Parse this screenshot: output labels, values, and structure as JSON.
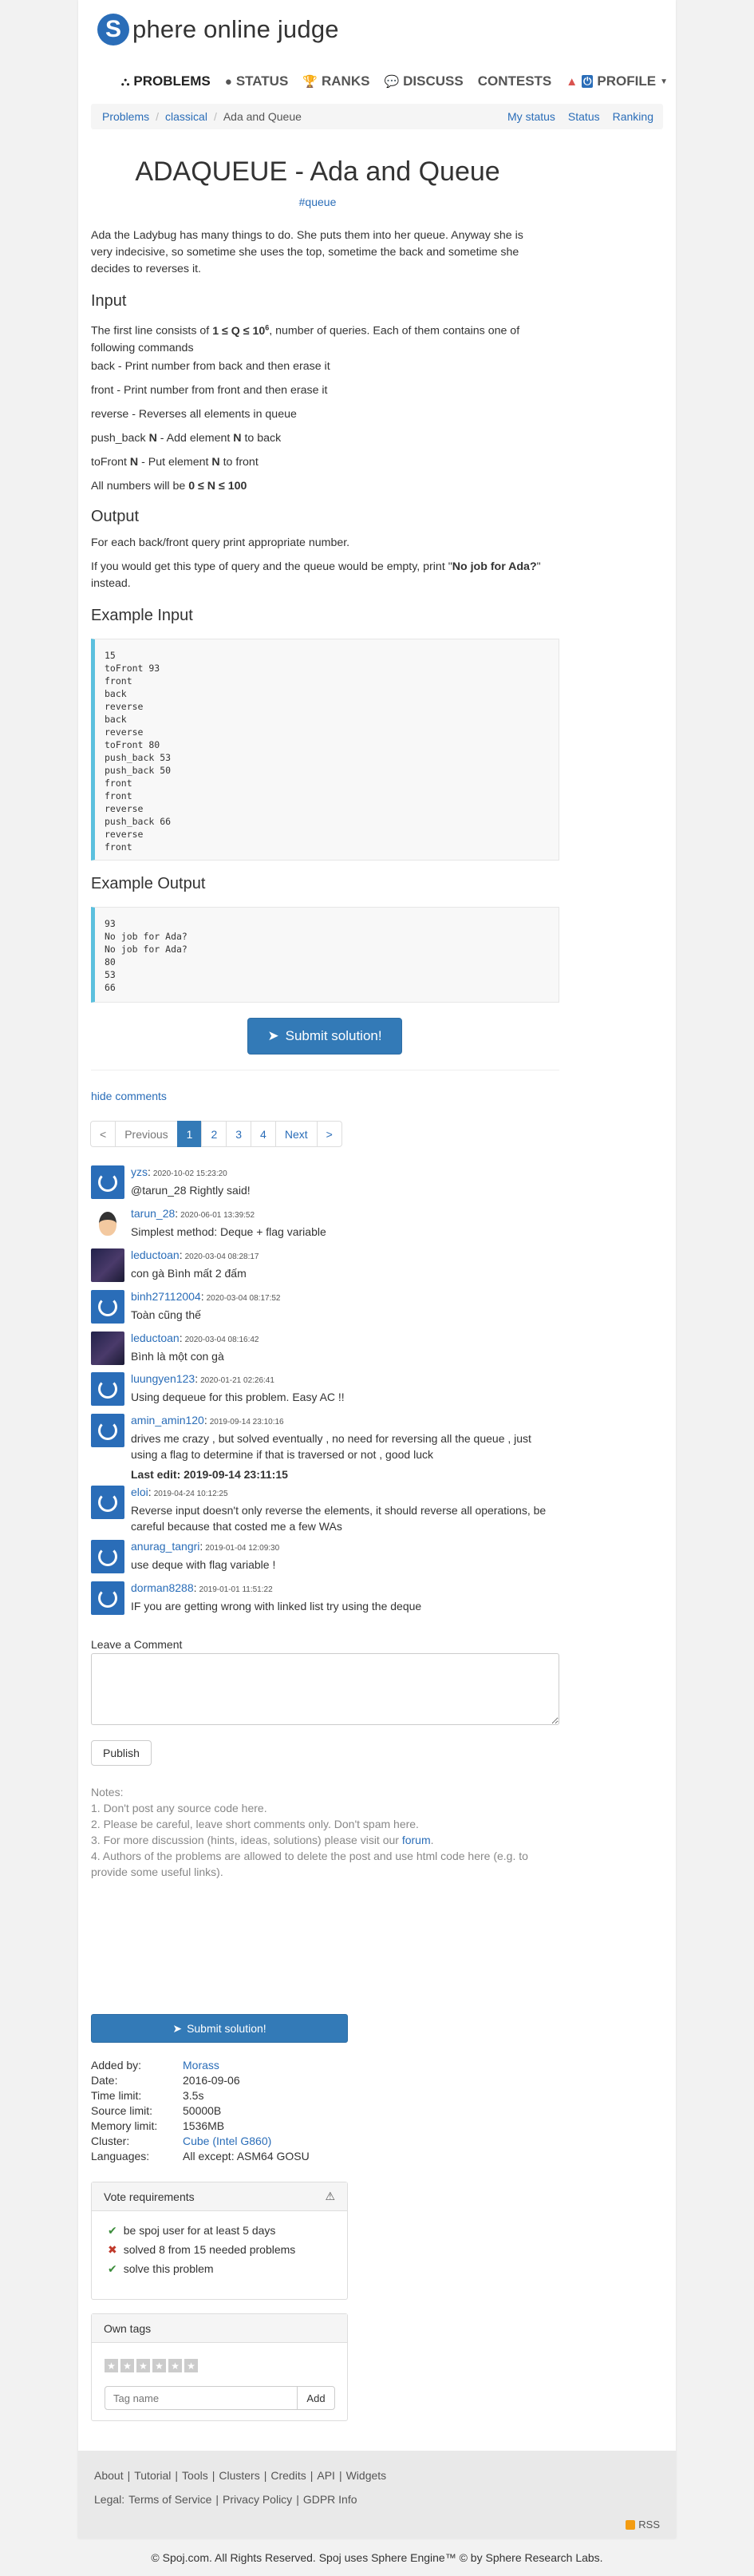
{
  "brand": {
    "initial": "S",
    "rest": "phere online judge"
  },
  "nav": [
    {
      "label": "Problems",
      "icon": "⛬"
    },
    {
      "label": "Status",
      "icon": "●"
    },
    {
      "label": "Ranks",
      "icon": "🏆"
    },
    {
      "label": "Discuss",
      "icon": "💬"
    },
    {
      "label": "Contests",
      "icon": ""
    },
    {
      "label": "Profile",
      "icon": "⏻"
    }
  ],
  "breadcrumb": {
    "items": [
      "Problems",
      "classical",
      "Ada and Queue"
    ],
    "right": [
      "My status",
      "Status",
      "Ranking"
    ]
  },
  "problem": {
    "title": "ADAQUEUE - Ada and Queue",
    "tag": "#queue",
    "intro": "Ada the Ladybug has many things to do. She puts them into her queue. Anyway she is very indecisive, so sometime she uses the top, sometime the back and sometime she decides to reverses it.",
    "input_heading": "Input",
    "input_first": "The first line consists of 1 ≤ Q ≤ 10^6, number of queries. Each of them contains one of following commands",
    "commands": [
      "back - Print number from back and then erase it",
      "front - Print number from front and then erase it",
      "reverse - Reverses all elements in queue",
      "push_back N - Add element N to back",
      "toFront N - Put element N to front"
    ],
    "bounds": "All numbers will be 0 ≤ N ≤ 100",
    "output_heading": "Output",
    "output_line1": "For each back/front query print appropriate number.",
    "output_line2": "If you would get this type of query and the queue would be empty, print \"No job for Ada?\" instead.",
    "example_input_heading": "Example Input",
    "example_input": "15\ntoFront 93\nfront\nback\nreverse\nback\nreverse\ntoFront 80\npush_back 53\npush_back 50\nfront\nfront\nreverse\npush_back 66\nreverse\nfront",
    "example_output_heading": "Example Output",
    "example_output": "93\nNo job for Ada?\nNo job for Ada?\n80\n53\n66",
    "submit_label": "Submit solution!"
  },
  "comments_toggle": "hide comments",
  "pager": [
    "<",
    "Previous",
    "1",
    "2",
    "3",
    "4",
    "Next",
    ">"
  ],
  "comments": [
    {
      "user": "yzs",
      "date": "2020-10-02 15:23:20",
      "text": "@tarun_28 Rightly said!"
    },
    {
      "user": "tarun_28",
      "date": "2020-06-01 13:39:52",
      "text": "Simplest method: Deque + flag variable"
    },
    {
      "user": "leductoan",
      "date": "2020-03-04 08:28:17",
      "text": "con gà Bình mất 2 đấm"
    },
    {
      "user": "binh27112004",
      "date": "2020-03-04 08:17:52",
      "text": "Toàn cũng thế"
    },
    {
      "user": "leductoan",
      "date": "2020-03-04 08:16:42",
      "text": "Bình là một con gà"
    },
    {
      "user": "luungyen123",
      "date": "2020-01-21 02:26:41",
      "text": "Using dequeue for this problem. Easy AC !!"
    },
    {
      "user": "amin_amin120",
      "date": "2019-09-14 23:10:16",
      "text": "drives me crazy , but solved eventually , no need for reversing all the queue , just using a flag to determine if that is traversed or not , good luck"
    },
    {
      "user": "eloi",
      "date": "2019-04-24 10:12:25",
      "edit": "Last edit: 2019-09-14 23:11:15",
      "text": "Reverse input doesn't only reverse the elements, it should reverse all operations, be careful because that costed me a few WAs"
    },
    {
      "user": "anurag_tangri",
      "date": "2019-01-04 12:09:30",
      "text": "use deque with flag variable !"
    },
    {
      "user": "dorman8288",
      "date": "2019-01-01 11:51:22",
      "text": "IF you are getting wrong with linked list try using the deque"
    }
  ],
  "comment_form": {
    "label": "Leave a Comment",
    "publish": "Publish"
  },
  "notes": {
    "title": "Notes:",
    "n1": "1. Don't post any source code here.",
    "n2": "2. Please be careful, leave short comments only. Don't spam here.",
    "n3a": "3. For more discussion (hints, ideas, solutions) please visit our ",
    "n3link": "forum",
    "n3b": ".",
    "n4": "4. Authors of the problems are allowed to delete the post and use html code here (e.g. to provide some useful links)."
  },
  "sidebar": {
    "submit_label": "Submit solution!",
    "info": [
      {
        "k": "Added by:",
        "v": "Morass",
        "link": true
      },
      {
        "k": "Date:",
        "v": "2016-09-06"
      },
      {
        "k": "Time limit:",
        "v": "3.5s"
      },
      {
        "k": "Source limit:",
        "v": "50000B"
      },
      {
        "k": "Memory limit:",
        "v": "1536MB"
      },
      {
        "k": "Cluster:",
        "v": "Cube (Intel G860)",
        "link": true
      },
      {
        "k": "Languages:",
        "v": "All except: ASM64 GOSU"
      }
    ],
    "vote_title": "Vote requirements",
    "vote_items": [
      {
        "ok": true,
        "text": "be spoj user for at least 5 days"
      },
      {
        "ok": false,
        "text": "solved 8 from 15 needed problems"
      },
      {
        "ok": true,
        "text": "solve this problem"
      }
    ],
    "tags_title": "Own tags",
    "tag_placeholder": "Tag name",
    "tag_add": "Add"
  },
  "footer": {
    "links": [
      "About",
      "Tutorial",
      "Tools",
      "Clusters",
      "Credits",
      "API",
      "Widgets"
    ],
    "legal_label": "Legal:",
    "legal": [
      "Terms of Service",
      "Privacy Policy",
      "GDPR Info"
    ],
    "rss": "RSS",
    "copyright": "© Spoj.com. All Rights Reserved. Spoj uses Sphere Engine™ © by Sphere Research Labs."
  },
  "colors": {
    "accent": "#337ab7",
    "link": "#2a6db8",
    "pre_border": "#5bc0de"
  }
}
